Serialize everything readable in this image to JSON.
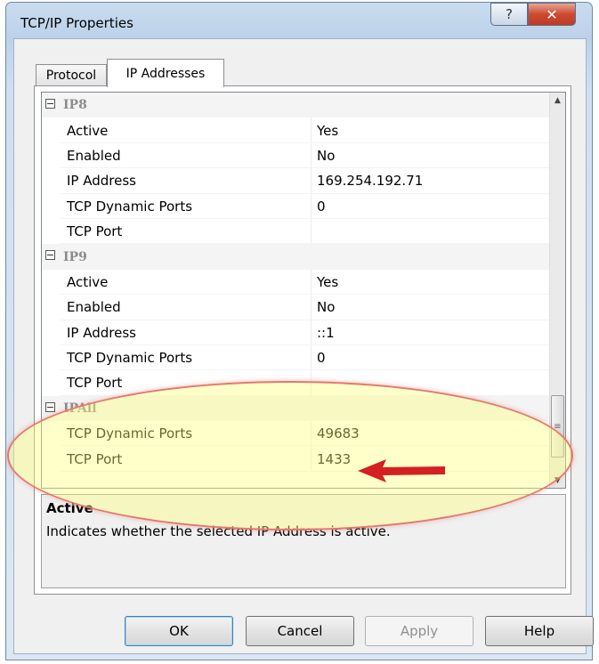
{
  "window": {
    "title": "TCP/IP Properties",
    "help_glyph": "?",
    "close_glyph": "✕"
  },
  "tabs": [
    {
      "label": "Protocol",
      "active": false
    },
    {
      "label": "IP Addresses",
      "active": true
    }
  ],
  "sections": [
    {
      "name": "IP8",
      "rows": [
        {
          "name": "Active",
          "value": "Yes"
        },
        {
          "name": "Enabled",
          "value": "No"
        },
        {
          "name": "IP Address",
          "value": "169.254.192.71"
        },
        {
          "name": "TCP Dynamic Ports",
          "value": "0"
        },
        {
          "name": "TCP Port",
          "value": ""
        }
      ]
    },
    {
      "name": "IP9",
      "rows": [
        {
          "name": "Active",
          "value": "Yes"
        },
        {
          "name": "Enabled",
          "value": "No"
        },
        {
          "name": "IP Address",
          "value": "::1"
        },
        {
          "name": "TCP Dynamic Ports",
          "value": "0"
        },
        {
          "name": "TCP Port",
          "value": ""
        }
      ]
    },
    {
      "name": "IPAll",
      "rows": [
        {
          "name": "TCP Dynamic Ports",
          "value": "49683"
        },
        {
          "name": "TCP Port",
          "value": "1433"
        }
      ]
    }
  ],
  "description": {
    "title": "Active",
    "text": "Indicates whether the selected IP Address is active."
  },
  "buttons": {
    "ok": "OK",
    "cancel": "Cancel",
    "apply": "Apply",
    "help": "Help"
  },
  "colors": {
    "highlight_fill": "#ffff78",
    "highlight_border": "#e4786e",
    "arrow": "#d42020"
  }
}
